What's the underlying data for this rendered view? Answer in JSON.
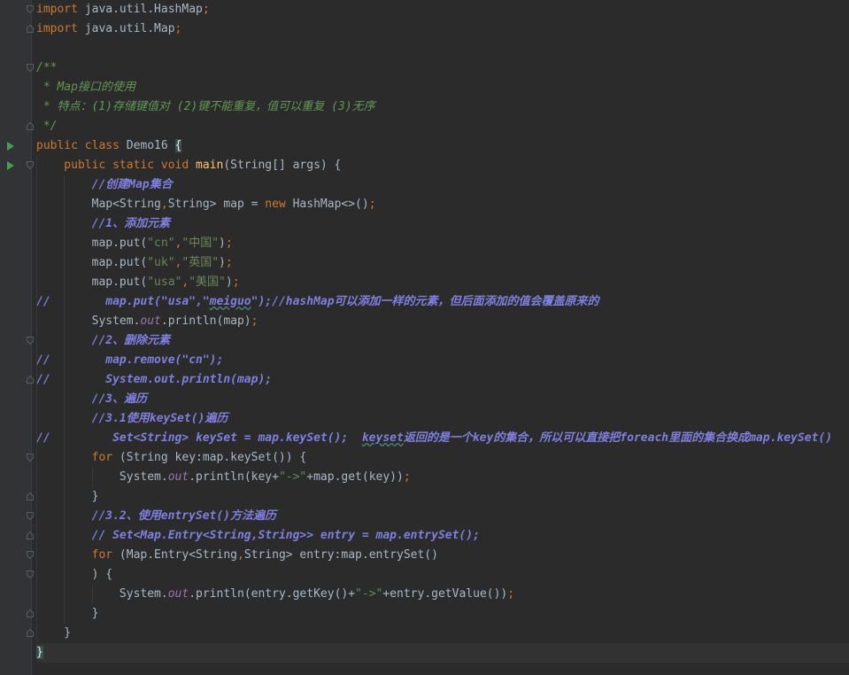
{
  "editor": {
    "lines": [
      {
        "tokens": [
          {
            "t": "import",
            "c": "kw"
          },
          {
            "t": " java.util.HashMap",
            "c": ""
          },
          {
            "t": ";",
            "c": "kw"
          }
        ]
      },
      {
        "tokens": [
          {
            "t": "import",
            "c": "kw"
          },
          {
            "t": " java.util.Map",
            "c": ""
          },
          {
            "t": ";",
            "c": "kw"
          }
        ]
      },
      {
        "tokens": []
      },
      {
        "tokens": [
          {
            "t": "/**",
            "c": "doc"
          }
        ]
      },
      {
        "tokens": [
          {
            "t": " * Map接口的使用",
            "c": "doc"
          }
        ]
      },
      {
        "tokens": [
          {
            "t": " * 特点：(1)存储键值对 (2)键不能重复，值可以重复 (3)无序",
            "c": "doc"
          }
        ]
      },
      {
        "tokens": [
          {
            "t": " */",
            "c": "doc"
          }
        ]
      },
      {
        "tokens": [
          {
            "t": "public class ",
            "c": "kw"
          },
          {
            "t": "Demo16 ",
            "c": ""
          },
          {
            "t": "{",
            "c": "brace"
          }
        ]
      },
      {
        "tokens": [
          {
            "t": "    public static void ",
            "c": "kw"
          },
          {
            "t": "main",
            "c": "fn"
          },
          {
            "t": "(String[] args) {",
            "c": ""
          }
        ]
      },
      {
        "tokens": [
          {
            "t": "        //创建Map集合",
            "c": "dl"
          }
        ]
      },
      {
        "tokens": [
          {
            "t": "        Map<String",
            "c": ""
          },
          {
            "t": ",",
            "c": "kw"
          },
          {
            "t": "String> map = ",
            "c": ""
          },
          {
            "t": "new ",
            "c": "kw"
          },
          {
            "t": "HashMap<>()",
            "c": ""
          },
          {
            "t": ";",
            "c": "kw"
          }
        ]
      },
      {
        "tokens": [
          {
            "t": "        //1、添加元素",
            "c": "dl"
          }
        ]
      },
      {
        "tokens": [
          {
            "t": "        map.put(",
            "c": ""
          },
          {
            "t": "\"cn\"",
            "c": "str"
          },
          {
            "t": ",",
            "c": "kw"
          },
          {
            "t": "\"中国\"",
            "c": "str"
          },
          {
            "t": ")",
            "c": ""
          },
          {
            "t": ";",
            "c": "kw"
          }
        ]
      },
      {
        "tokens": [
          {
            "t": "        map.put(",
            "c": ""
          },
          {
            "t": "\"uk\"",
            "c": "str"
          },
          {
            "t": ",",
            "c": "kw"
          },
          {
            "t": "\"英国\"",
            "c": "str"
          },
          {
            "t": ")",
            "c": ""
          },
          {
            "t": ";",
            "c": "kw"
          }
        ]
      },
      {
        "tokens": [
          {
            "t": "        map.put(",
            "c": ""
          },
          {
            "t": "\"usa\"",
            "c": "str"
          },
          {
            "t": ",",
            "c": "kw"
          },
          {
            "t": "\"美国\"",
            "c": "str"
          },
          {
            "t": ")",
            "c": ""
          },
          {
            "t": ";",
            "c": "kw"
          }
        ]
      },
      {
        "tokens": [
          {
            "t": "//        map.put(\"usa\",\"",
            "c": "dl"
          },
          {
            "t": "meiguo",
            "c": "dlu"
          },
          {
            "t": "\");//hashMap可以添加一样的元素，但后面添加的值会覆盖原来的",
            "c": "dl"
          }
        ]
      },
      {
        "tokens": [
          {
            "t": "        System.",
            "c": ""
          },
          {
            "t": "out",
            "c": "field"
          },
          {
            "t": ".println(map)",
            "c": ""
          },
          {
            "t": ";",
            "c": "kw"
          }
        ]
      },
      {
        "tokens": [
          {
            "t": "        //2、删除元素",
            "c": "dl"
          }
        ]
      },
      {
        "tokens": [
          {
            "t": "//        map.remove(\"cn\");",
            "c": "dl"
          }
        ]
      },
      {
        "tokens": [
          {
            "t": "//        System.out.println(map);",
            "c": "dl"
          }
        ]
      },
      {
        "tokens": [
          {
            "t": "        //3、遍历",
            "c": "dl"
          }
        ]
      },
      {
        "tokens": [
          {
            "t": "        //3.1使用keySet()遍历",
            "c": "dl"
          }
        ]
      },
      {
        "tokens": [
          {
            "t": "//         Set<String> keySet = map.keySet();  ",
            "c": "dl"
          },
          {
            "t": "keyset",
            "c": "dlu"
          },
          {
            "t": "返回的是一个key的集合，所以可以直接把foreach里面的集合换成map.keySet()",
            "c": "dl"
          }
        ]
      },
      {
        "tokens": [
          {
            "t": "        for ",
            "c": "kw"
          },
          {
            "t": "(String key:map.keySet()) {",
            "c": ""
          }
        ]
      },
      {
        "tokens": [
          {
            "t": "            System.",
            "c": ""
          },
          {
            "t": "out",
            "c": "field"
          },
          {
            "t": ".println(key+",
            "c": ""
          },
          {
            "t": "\"->\"",
            "c": "str"
          },
          {
            "t": "+map.get(key))",
            "c": ""
          },
          {
            "t": ";",
            "c": "kw"
          }
        ]
      },
      {
        "tokens": [
          {
            "t": "        }",
            "c": ""
          }
        ]
      },
      {
        "tokens": [
          {
            "t": "        //3.2、使用entrySet()方法遍历",
            "c": "dl"
          }
        ]
      },
      {
        "tokens": [
          {
            "t": "        // Set<Map.Entry<String,String>> entry = map.entrySet();",
            "c": "dl"
          }
        ]
      },
      {
        "tokens": [
          {
            "t": "        for ",
            "c": "kw"
          },
          {
            "t": "(Map.Entry<String",
            "c": ""
          },
          {
            "t": ",",
            "c": "kw"
          },
          {
            "t": "String> entry:map.entrySet()",
            "c": ""
          }
        ]
      },
      {
        "tokens": [
          {
            "t": "        ) {",
            "c": ""
          }
        ]
      },
      {
        "tokens": [
          {
            "t": "            System.",
            "c": ""
          },
          {
            "t": "out",
            "c": "field"
          },
          {
            "t": ".println(entry.getKey()+",
            "c": ""
          },
          {
            "t": "\"->\"",
            "c": "str"
          },
          {
            "t": "+entry.getValue())",
            "c": ""
          },
          {
            "t": ";",
            "c": "kw"
          }
        ]
      },
      {
        "tokens": [
          {
            "t": "        }",
            "c": ""
          }
        ]
      },
      {
        "tokens": [
          {
            "t": "    }",
            "c": ""
          }
        ]
      },
      {
        "tokens": [
          {
            "t": "}",
            "c": "brace"
          }
        ]
      }
    ]
  },
  "gutter": {
    "run_icon": "run-triangle-icon",
    "fold_icon": "fold-marker-icon"
  },
  "colors": {
    "background": "#2b2b2b",
    "gutter": "#313335",
    "keyword": "#cc7832",
    "string": "#6a8759",
    "doc_comment": "#629755",
    "todo_comment": "#7f7fdf",
    "method": "#ffc66d",
    "field": "#9876aa",
    "run_icon": "#499c54"
  }
}
